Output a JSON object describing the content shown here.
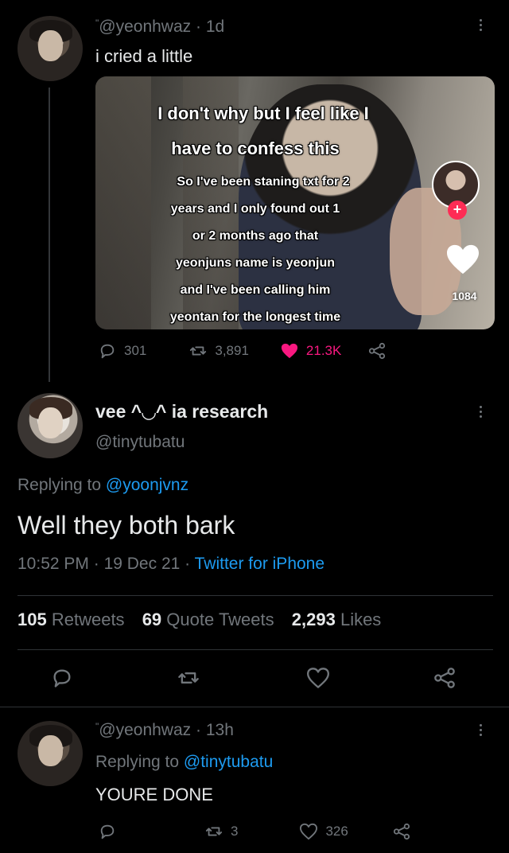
{
  "tweet1": {
    "handle": "@yeonhwaz",
    "dot": "·",
    "time": "1d",
    "text": "i cried a little",
    "media": {
      "caption_lines": [
        "I don't why but I feel like I",
        "have to confess this",
        "So I've been staning txt for 2",
        "years and I only found out 1",
        "or 2 months ago that",
        "yeonjuns name is yeonjun",
        "and I've been calling him",
        "yeontan for the longest time"
      ],
      "likes": "1084",
      "plus": "+"
    },
    "actions": {
      "replies": "301",
      "retweets": "3,891",
      "likes": "21.3K"
    }
  },
  "tweet2": {
    "name": "vee ^◡^ ia research",
    "handle": "@tinytubatu",
    "replying_prefix": "Replying to",
    "replying_to": "@yoonjvnz",
    "text": "Well they both bark",
    "time": "10:52 PM",
    "date": "19 Dec 21",
    "dot": "·",
    "source": "Twitter for iPhone",
    "stats": {
      "retweets_count": "105",
      "retweets_label": "Retweets",
      "quotes_count": "69",
      "quotes_label": "Quote Tweets",
      "likes_count": "2,293",
      "likes_label": "Likes"
    }
  },
  "tweet3": {
    "handle": "@yeonhwaz",
    "dot": "·",
    "time": "13h",
    "replying_prefix": "Replying to",
    "replying_to": "@tinytubatu",
    "text": "YOURE DONE",
    "actions": {
      "retweets": "3",
      "likes": "326"
    }
  },
  "colors": {
    "background": "#000000",
    "text": "#e7e9ea",
    "muted": "#71767b",
    "link": "#1d9bf0",
    "like": "#f91880"
  }
}
